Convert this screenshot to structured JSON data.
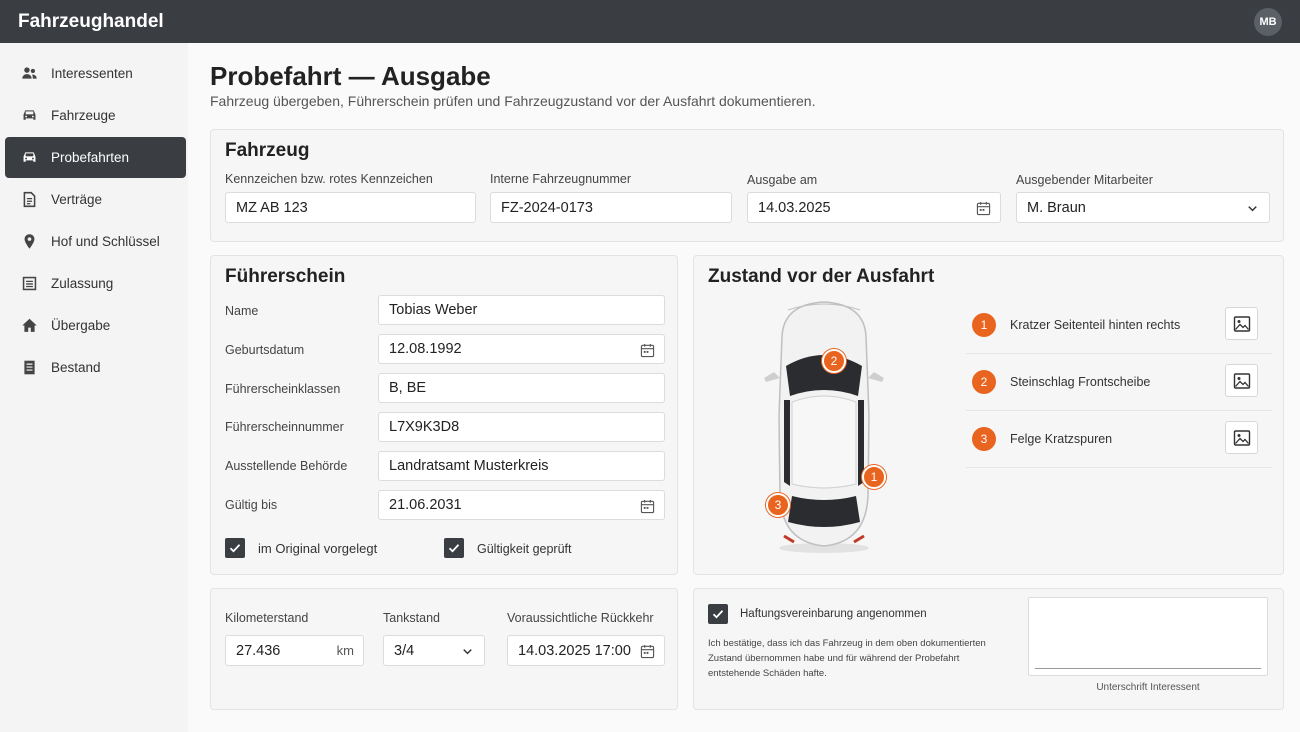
{
  "app": {
    "title": "Fahrzeughandel",
    "user_initials": "MB"
  },
  "sidebar": {
    "items": [
      {
        "label": "Interessenten",
        "icon": "people-icon"
      },
      {
        "label": "Fahrzeuge",
        "icon": "car-icon"
      },
      {
        "label": "Probefahrten",
        "icon": "car-icon",
        "active": true
      },
      {
        "label": "Verträge",
        "icon": "document-icon"
      },
      {
        "label": "Hof und Schlüssel",
        "icon": "location-pin-icon"
      },
      {
        "label": "Zulassung",
        "icon": "list-icon"
      },
      {
        "label": "Übergabe",
        "icon": "home-icon"
      },
      {
        "label": "Bestand",
        "icon": "inventory-icon"
      }
    ]
  },
  "page": {
    "title": "Probefahrt — Ausgabe",
    "subtitle": "Fahrzeug übergeben, Führerschein prüfen und Fahrzeugzustand vor der Ausfahrt dokumentieren."
  },
  "fahrzeug": {
    "title": "Fahrzeug",
    "kennzeichen_label": "Kennzeichen bzw. rotes Kennzeichen",
    "kennzeichen_value": "MZ AB 123",
    "fzgnr_label": "Interne Fahrzeugnummer",
    "fzgnr_value": "FZ-2024-0173",
    "ausgabe_label": "Ausgabe am",
    "ausgabe_value": "14.03.2025",
    "mitarbeiter_label": "Ausgebender Mitarbeiter",
    "mitarbeiter_value": "M. Braun"
  },
  "fuehrerschein": {
    "title": "Führerschein",
    "name_label": "Name",
    "name_value": "Tobias Weber",
    "geburt_label": "Geburtsdatum",
    "geburt_value": "12.08.1992",
    "klassen_label": "Führerscheinklassen",
    "klassen_value": "B, BE",
    "nummer_label": "Führerscheinnummer",
    "nummer_value": "L7X9K3D8",
    "behoerde_label": "Ausstellende Behörde",
    "behoerde_value": "Landratsamt Musterkreis",
    "gueltig_label": "Gültig bis",
    "gueltig_value": "21.06.2031",
    "original_label": "im Original vorgelegt",
    "original_checked": true,
    "gueltigkeit_label": "Gültigkeit geprüft",
    "gueltigkeit_checked": true
  },
  "zustand": {
    "title": "Zustand vor der Ausfahrt",
    "damages": [
      {
        "num": "1",
        "text": "Kratzer Seitenteil hinten rechts"
      },
      {
        "num": "2",
        "text": "Steinschlag Frontscheibe"
      },
      {
        "num": "3",
        "text": "Felge Kratzspuren"
      }
    ],
    "markers": [
      "2",
      "1",
      "3"
    ],
    "accent_color": "#e9641f"
  },
  "fahrt": {
    "km_label": "Kilometerstand",
    "km_value": "27.436",
    "km_unit": "km",
    "tank_label": "Tankstand",
    "tank_value": "3/4",
    "rueckkehr_label": "Voraussichtliche Rückkehr",
    "rueckkehr_value": "14.03.2025 17:00"
  },
  "haftung": {
    "label": "Haftungsvereinbarung angenommen",
    "checked": true,
    "text": "Ich bestätige, dass ich das Fahrzeug in dem oben dokumentierten Zustand übernommen habe und für während der Probefahrt entstehende Schäden hafte.",
    "signature_label": "Unterschrift Interessent"
  }
}
